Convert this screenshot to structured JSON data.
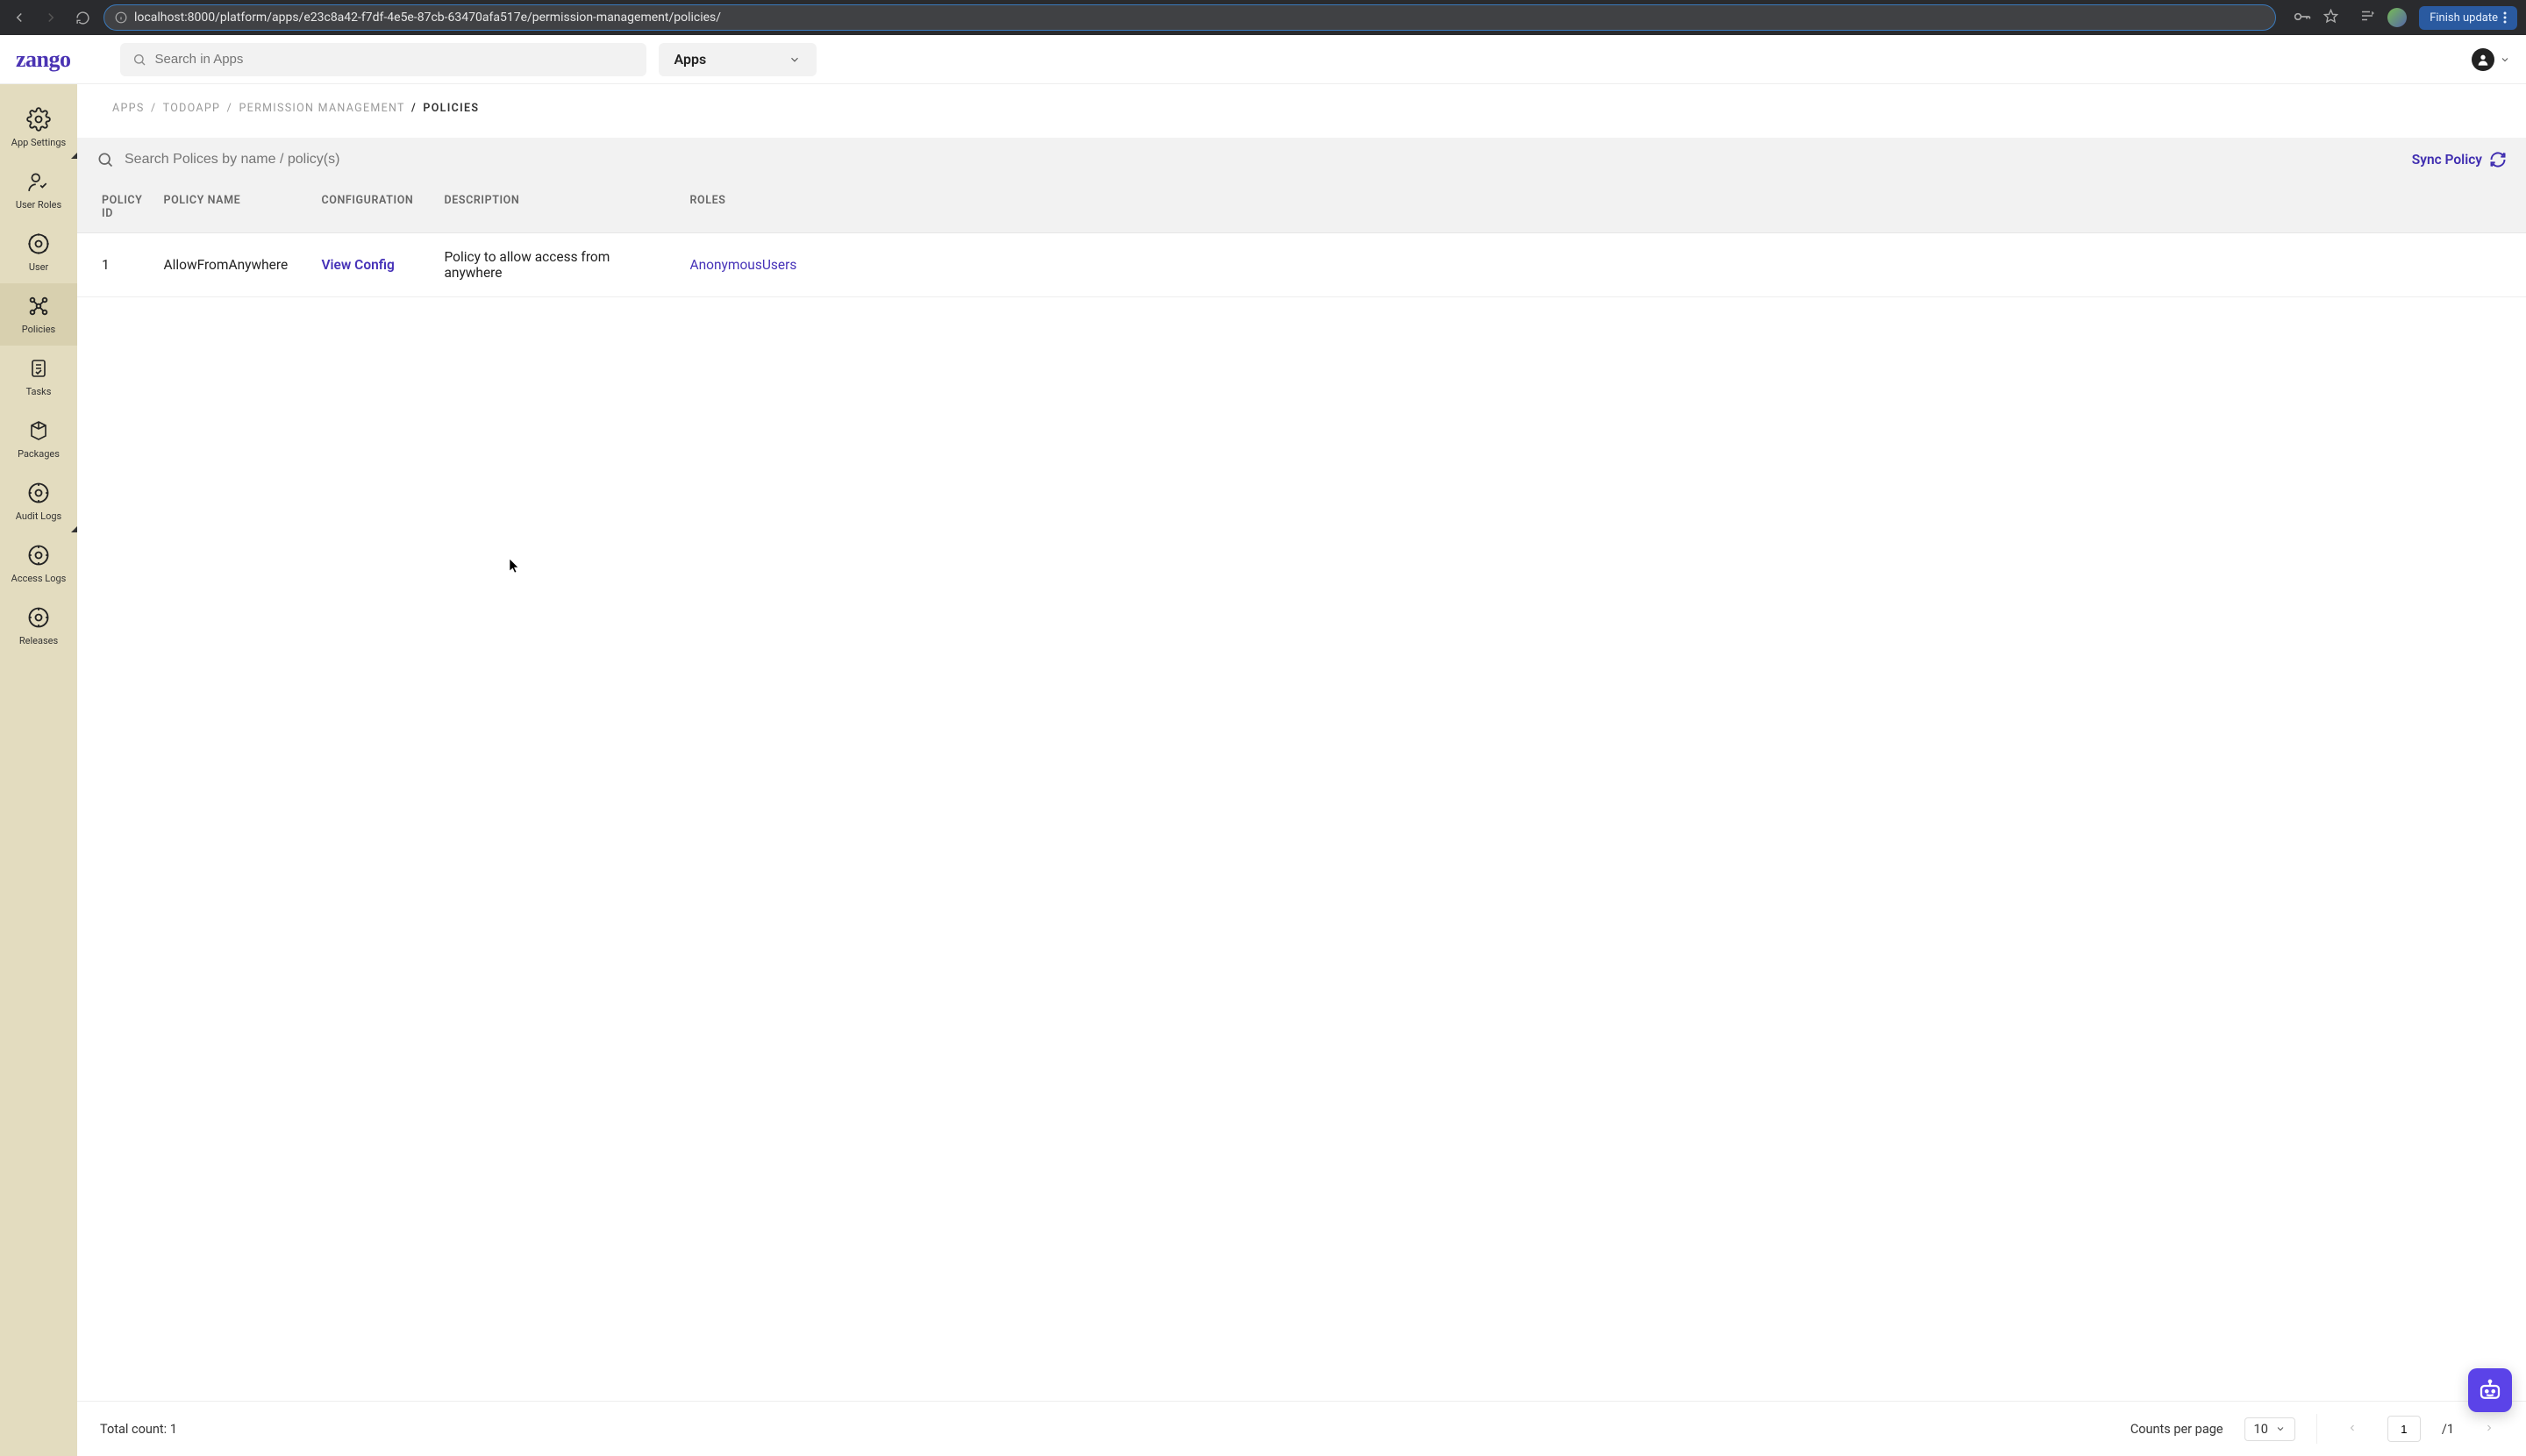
{
  "browser": {
    "url": "localhost:8000/platform/apps/e23c8a42-f7df-4e5e-87cb-63470afa517e/permission-management/policies/",
    "finish_update_label": "Finish update"
  },
  "header": {
    "logo": "zango",
    "search_placeholder": "Search in Apps",
    "context_selector": "Apps"
  },
  "sidebar": {
    "items": [
      {
        "label": "App Settings"
      },
      {
        "label": "User Roles"
      },
      {
        "label": "User"
      },
      {
        "label": "Policies"
      },
      {
        "label": "Tasks"
      },
      {
        "label": "Packages"
      },
      {
        "label": "Audit Logs"
      },
      {
        "label": "Access Logs"
      },
      {
        "label": "Releases"
      }
    ],
    "active_index": 3
  },
  "breadcrumb": {
    "parts": [
      "APPS",
      "TODOAPP",
      "PERMISSION MANAGEMENT"
    ],
    "current": "POLICIES",
    "sep": "/"
  },
  "toolbar": {
    "search_placeholder": "Search Polices by name / policy(s)",
    "sync_label": "Sync Policy"
  },
  "table": {
    "columns": [
      "POLICY ID",
      "POLICY NAME",
      "CONFIGURATION",
      "DESCRIPTION",
      "ROLES"
    ],
    "rows": [
      {
        "id": "1",
        "name": "AllowFromAnywhere",
        "config_label": "View Config",
        "description": "Policy to allow access from anywhere",
        "roles": "AnonymousUsers"
      }
    ]
  },
  "footer": {
    "total_label": "Total count:",
    "total": "1",
    "counts_label": "Counts per page",
    "page_size": "10",
    "page_current": "1",
    "page_total_prefix": "/",
    "page_total": "1"
  },
  "colors": {
    "accent": "#4632b8",
    "sidebar": "#e3dcbf"
  }
}
